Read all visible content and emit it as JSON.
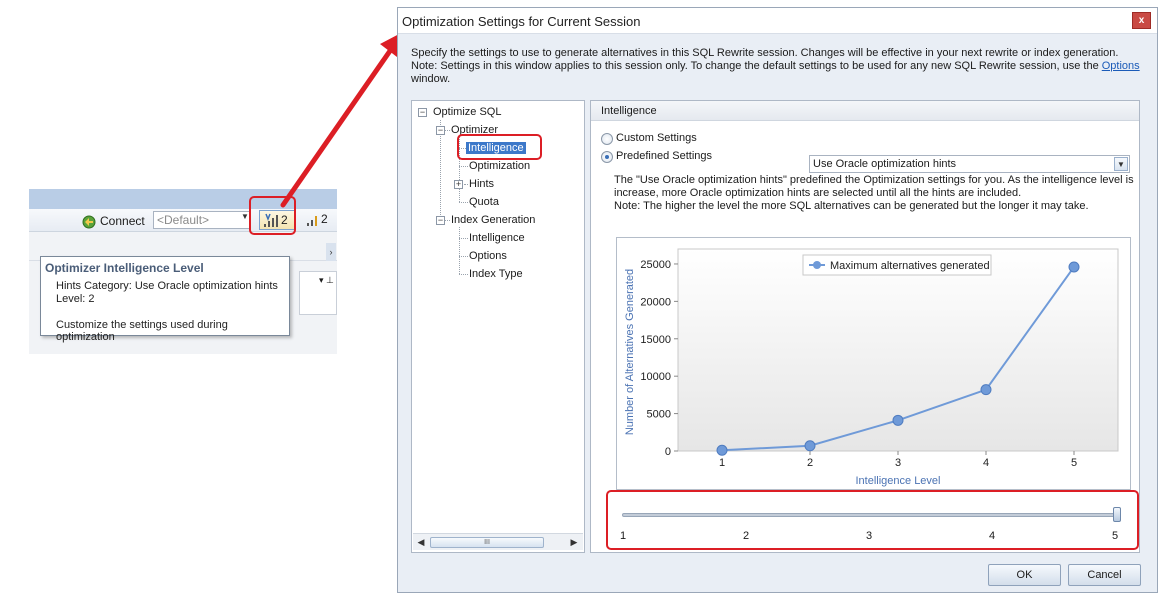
{
  "left_snippet": {
    "connect_label": "Connect",
    "default_combo_value": "<Default>",
    "intelligence_button_value": "2",
    "second_button_value": "2",
    "tooltip": {
      "title": "Optimizer Intelligence Level",
      "line1": "Hints Category: Use Oracle optimization hints",
      "line2": "Level: 2",
      "line3": "Customize the settings used during optimization"
    }
  },
  "dialog": {
    "title": "Optimization Settings for Current Session",
    "close_glyph": "x",
    "description_1": "Specify the settings to use to generate alternatives in this SQL Rewrite session. Changes will be effective in your next rewrite or index generation.",
    "description_2_pre": "Note: Settings in this window applies to this session only. To change the default settings to be used for any new SQL Rewrite session, use the ",
    "description_2_link": "Options",
    "description_3": "window.",
    "tree": {
      "root": "Optimize SQL",
      "optimizer": "Optimizer",
      "optimizer_children": [
        "Intelligence",
        "Optimization",
        "Hints",
        "Quota"
      ],
      "index_generation": "Index Generation",
      "index_children": [
        "Intelligence",
        "Options",
        "Index Type"
      ],
      "scroll_grip": "III"
    },
    "panel": {
      "group_title": "Intelligence",
      "custom_settings_label": "Custom Settings",
      "predefined_settings_label": "Predefined Settings",
      "predefined_selected": true,
      "predefined_value": "Use Oracle optimization hints",
      "note_1": "The \"Use Oracle optimization hints\" predefined the Optimization settings for you. As the intelligence level is",
      "note_2": "increase, more Oracle optimization hints are selected until all the hints are included.",
      "note_3": "Note: The higher the level the more SQL alternatives can be generated but the longer it may take."
    },
    "slider": {
      "labels": [
        "1",
        "2",
        "3",
        "4",
        "5"
      ],
      "value": 5
    },
    "buttons": {
      "ok": "OK",
      "cancel": "Cancel"
    }
  },
  "colors": {
    "highlight_red": "#dc1e25",
    "series_blue": "#6f9ad8",
    "axis_title_blue": "#4b73b3",
    "selection_blue": "#3c78c9"
  },
  "chart_data": {
    "type": "line",
    "x": [
      1,
      2,
      3,
      4,
      5
    ],
    "series": [
      {
        "name": "Maximum alternatives generated",
        "values": [
          100,
          700,
          4100,
          8200,
          24600
        ]
      }
    ],
    "xlabel": "Intelligence Level",
    "ylabel": "Number of Alternatives Generated",
    "x_ticks": [
      "1",
      "2",
      "3",
      "4",
      "5"
    ],
    "y_ticks": [
      "0",
      "5000",
      "10000",
      "15000",
      "20000",
      "25000"
    ],
    "ylim": [
      0,
      25000
    ],
    "grid": false,
    "legend_position": "top-center"
  }
}
